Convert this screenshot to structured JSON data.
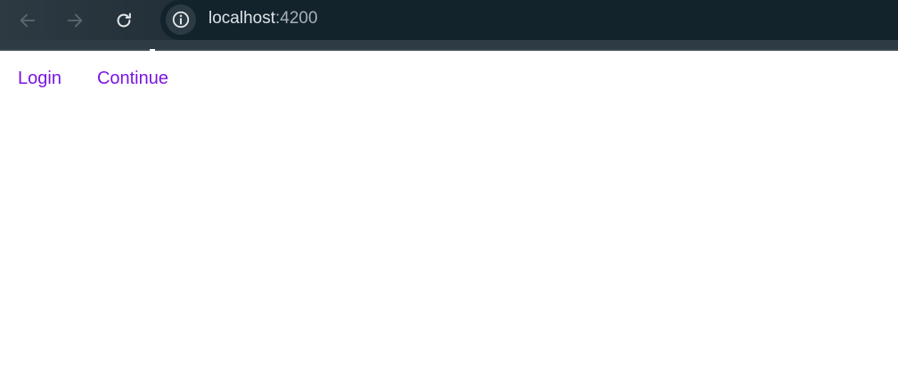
{
  "browser": {
    "back_icon": "arrow-left-icon",
    "forward_icon": "arrow-right-icon",
    "reload_icon": "reload-icon",
    "site_info_icon": "info-icon",
    "url_host": "localhost",
    "url_port": ":4200",
    "colors": {
      "toolbar": "#1d2a33",
      "omnibox": "#13232c",
      "url_host": "#dfe4e8",
      "url_port": "#a7b0b6"
    }
  },
  "page": {
    "links": [
      {
        "label": "Login"
      },
      {
        "label": "Continue"
      }
    ],
    "colors": {
      "link": "#7a15e2",
      "background": "#ffffff"
    }
  }
}
